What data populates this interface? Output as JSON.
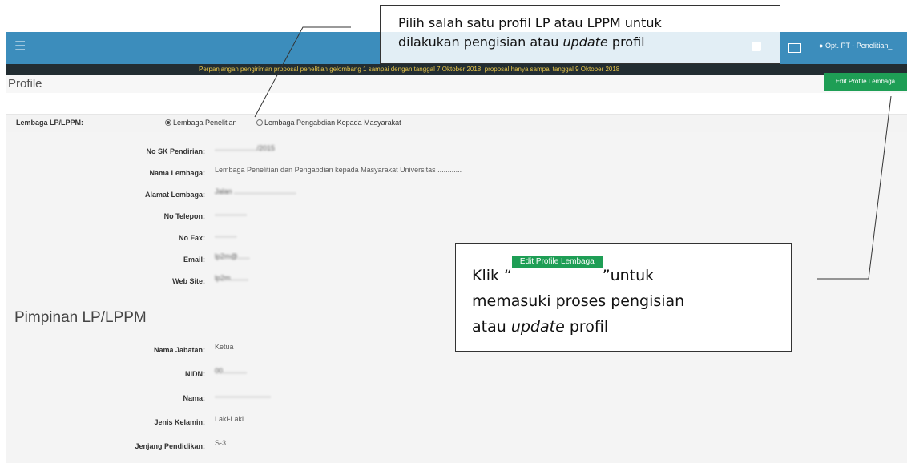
{
  "header": {
    "user_label": "Opt. PT - Penelitian_"
  },
  "announcement": "Perpanjangan pengiriman proposal penelitian gelombang 1 sampai dengan tanggal 7 Oktober 2018, proposal hanya sampai tanggal 9 Oktober 2018",
  "page": {
    "title": "Profile",
    "edit_button": "Edit Profile Lembaga"
  },
  "lembaga": {
    "label": "Lembaga LP/LPPM:",
    "options": [
      "Lembaga Penelitian",
      "Lembaga Pengabdian Kepada Masyarakat"
    ],
    "selected_index": 0
  },
  "profile_fields": [
    {
      "label": "No SK Pendirian:",
      "value": "...................../2015"
    },
    {
      "label": "Nama Lembaga:",
      "value": "Lembaga Penelitian dan Pengabdian kepada Masyarakat Universitas ............"
    },
    {
      "label": "Alamat Lembaga:",
      "value": "Jalan ..............................."
    },
    {
      "label": "No Telepon:",
      "value": "................"
    },
    {
      "label": "No Fax:",
      "value": "..........."
    },
    {
      "label": "Email:",
      "value": "lp2m@......"
    },
    {
      "label": "Web Site:",
      "value": "lp2m........."
    }
  ],
  "pimpinan": {
    "title": "Pimpinan LP/LPPM",
    "fields": [
      {
        "label": "Nama Jabatan:",
        "value": "Ketua"
      },
      {
        "label": "NIDN:",
        "value": "00............"
      },
      {
        "label": "Nama:",
        "value": "............................"
      },
      {
        "label": "Jenis Kelamin:",
        "value": "Laki-Laki"
      },
      {
        "label": "Jenjang Pendidikan:",
        "value": "S-3"
      }
    ]
  },
  "annotations": {
    "callout1": {
      "line1": "Pilih salah satu profil LP atau LPPM untuk",
      "line2_prefix": "dilakukan pengisian atau ",
      "line2_italic": "update",
      "line2_suffix": " profil"
    },
    "callout2": {
      "prefix": "Klik “",
      "button_text": "Edit Profile Lembaga",
      "after_button": "”untuk",
      "line2": "memasuki proses pengisian",
      "line3_prefix": "atau ",
      "line3_italic": "update",
      "line3_suffix": " profil"
    }
  }
}
